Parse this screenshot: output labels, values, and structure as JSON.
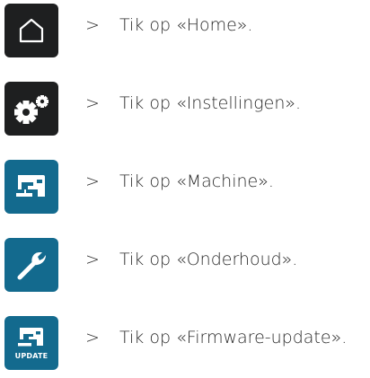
{
  "steps": [
    {
      "bullet": ">",
      "text": "Tik op «Home».",
      "icon": "home-icon",
      "bg": "#1e1f20"
    },
    {
      "bullet": ">",
      "text": "Tik op «Instellingen».",
      "icon": "gears-icon",
      "bg": "#1e1f20"
    },
    {
      "bullet": ">",
      "text": "Tik op «Machine».",
      "icon": "sewing-machine-icon",
      "bg": "#136a8e"
    },
    {
      "bullet": ">",
      "text": "Tik op «Onderhoud».",
      "icon": "wrench-icon",
      "bg": "#136a8e"
    },
    {
      "bullet": ">",
      "text": "Tik op «Firmware-update».",
      "icon": "firmware-update-icon",
      "bg": "#136a8e",
      "icon_label": "UPDATE"
    }
  ]
}
